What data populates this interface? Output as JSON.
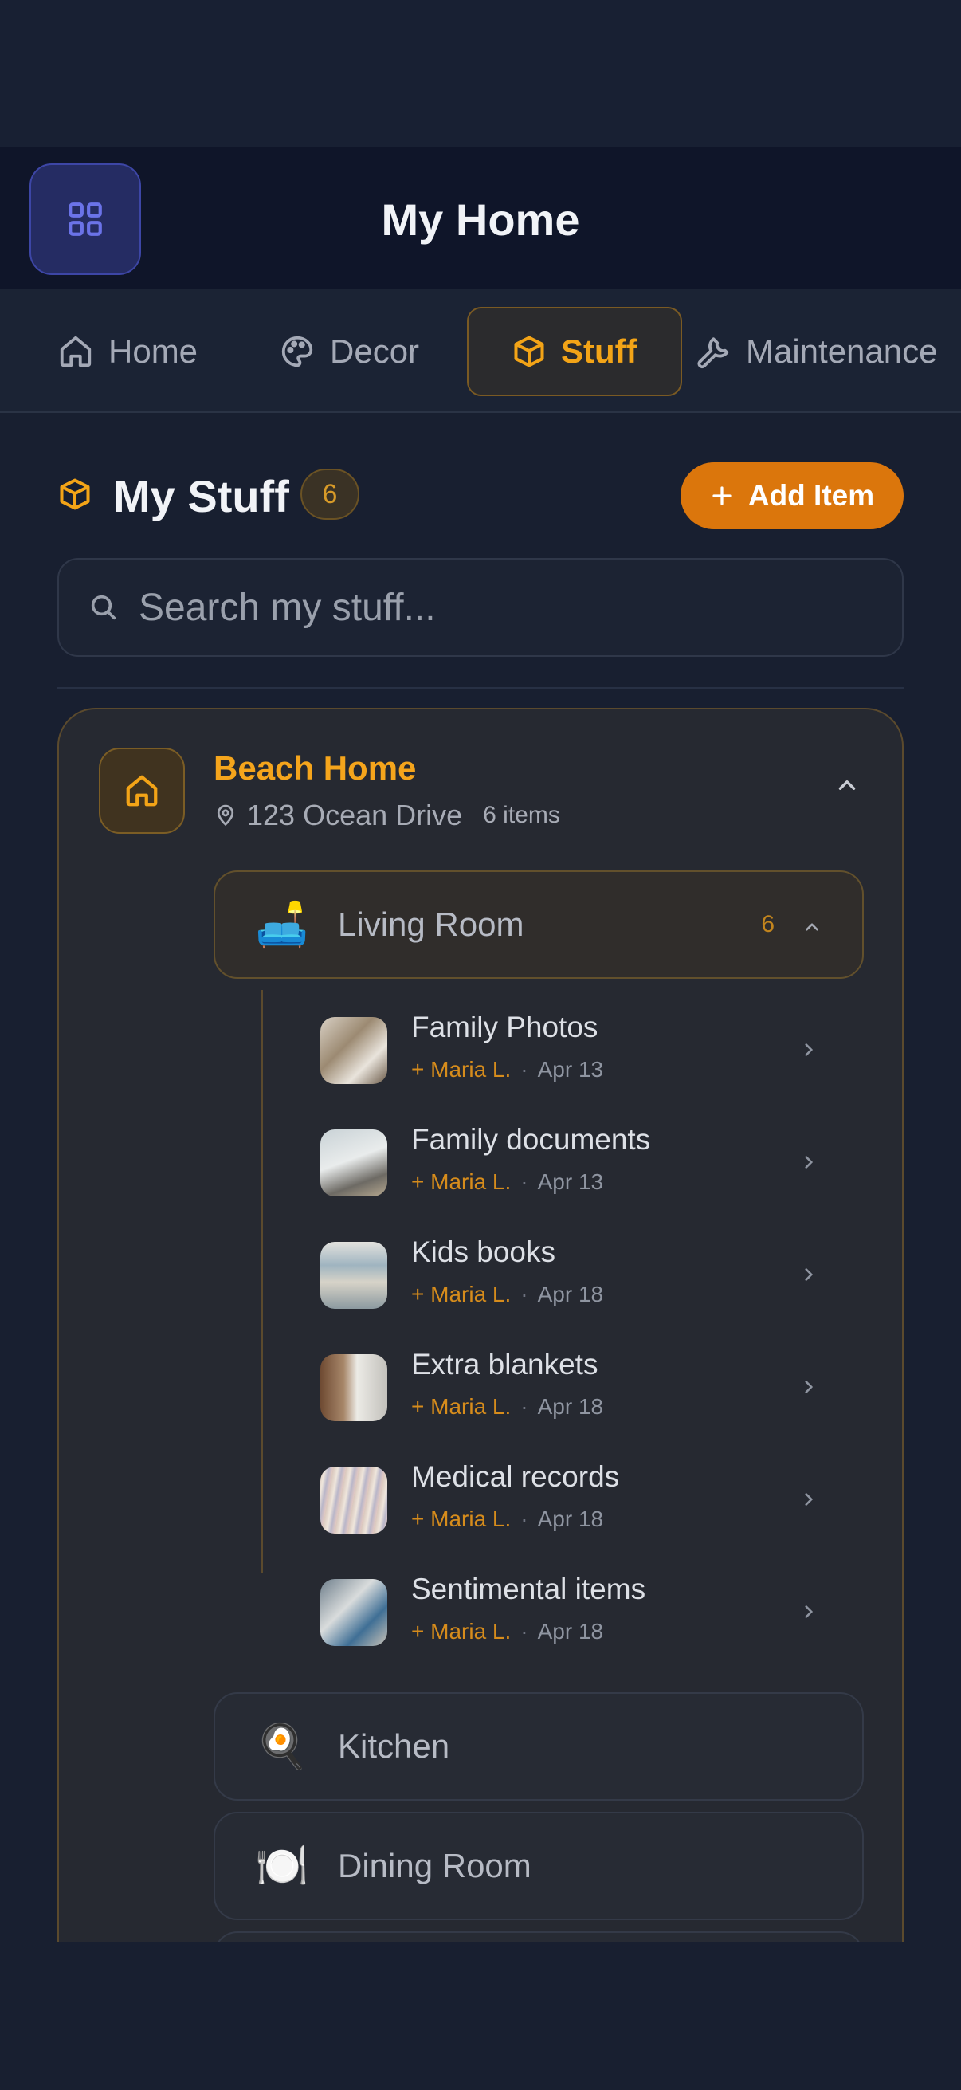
{
  "app": {
    "title": "My Home"
  },
  "tabs": [
    {
      "label": "Home",
      "icon": "house-icon",
      "active": false
    },
    {
      "label": "Decor",
      "icon": "palette-icon",
      "active": false
    },
    {
      "label": "Stuff",
      "icon": "box-icon",
      "active": true
    },
    {
      "label": "Maintenance",
      "icon": "wrench-icon",
      "active": false
    }
  ],
  "section": {
    "title": "My Stuff",
    "count": "6",
    "add_label": "Add Item"
  },
  "search": {
    "placeholder": "Search my stuff..."
  },
  "home": {
    "name": "Beach Home",
    "address": "123 Ocean Drive",
    "items_count": "6 items",
    "rooms": [
      {
        "name": "Living Room",
        "emoji": "🛋️",
        "count": "6",
        "expanded": true,
        "items": [
          {
            "name": "Family Photos",
            "added_by": "+ Maria L.",
            "date": "Apr 13"
          },
          {
            "name": "Family documents",
            "added_by": "+ Maria L.",
            "date": "Apr 13"
          },
          {
            "name": "Kids books",
            "added_by": "+ Maria L.",
            "date": "Apr 18"
          },
          {
            "name": "Extra blankets",
            "added_by": "+ Maria L.",
            "date": "Apr 18"
          },
          {
            "name": "Medical records",
            "added_by": "+ Maria L.",
            "date": "Apr 18"
          },
          {
            "name": "Sentimental items",
            "added_by": "+ Maria L.",
            "date": "Apr 18"
          }
        ]
      },
      {
        "name": "Kitchen",
        "emoji": "🍳",
        "expanded": false
      },
      {
        "name": "Dining Room",
        "emoji": "🍽️",
        "expanded": false
      }
    ]
  },
  "colors": {
    "accent": "#f5a51c",
    "button": "#db760c",
    "background": "#181f30"
  }
}
